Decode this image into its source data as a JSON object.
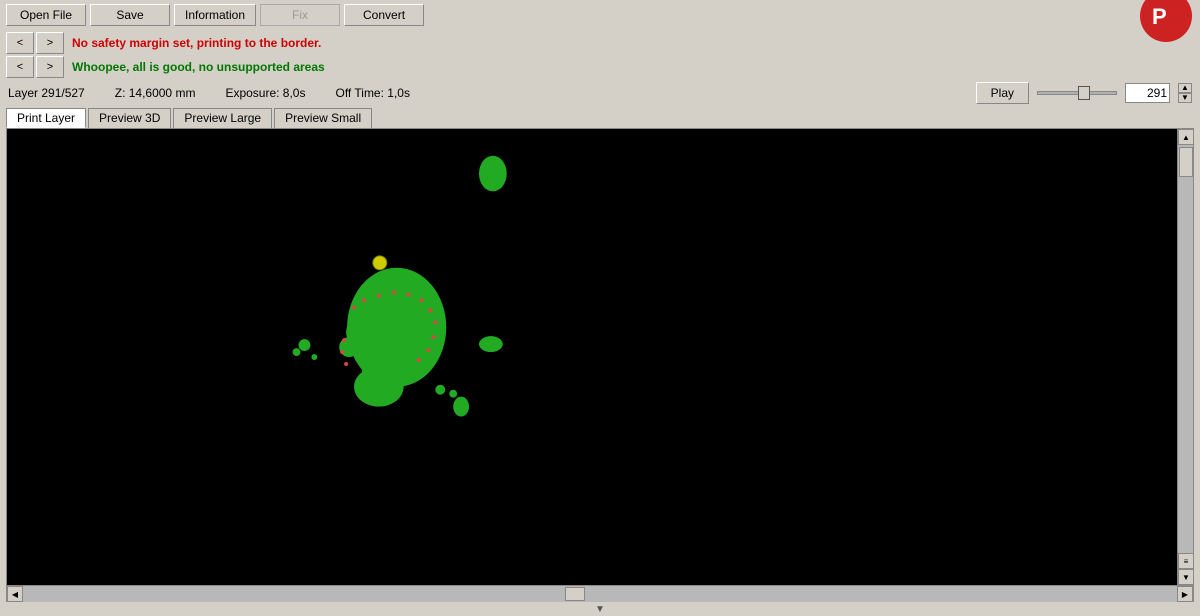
{
  "toolbar": {
    "open_file_label": "Open File",
    "save_label": "Save",
    "information_label": "Information",
    "fix_label": "Fix",
    "convert_label": "Convert"
  },
  "messages": {
    "warning": "No safety margin set, printing to the border.",
    "ok": "Whoopee, all is good, no unsupported areas"
  },
  "nav": {
    "prev_label": "<",
    "next_label": ">"
  },
  "status": {
    "layer": "Layer 291/527",
    "z": "Z: 14,6000 mm",
    "exposure": "Exposure: 8,0s",
    "off_time": "Off Time: 1,0s",
    "play_label": "Play",
    "layer_value": "291"
  },
  "tabs": {
    "print_layer": "Print Layer",
    "preview_3d": "Preview 3D",
    "preview_large": "Preview Large",
    "preview_small": "Preview Small"
  },
  "canvas": {
    "background": "#000000"
  },
  "scrollbars": {
    "up_arrow": "▲",
    "down_arrow": "▼",
    "left_arrow": "◀",
    "right_arrow": "▶"
  }
}
